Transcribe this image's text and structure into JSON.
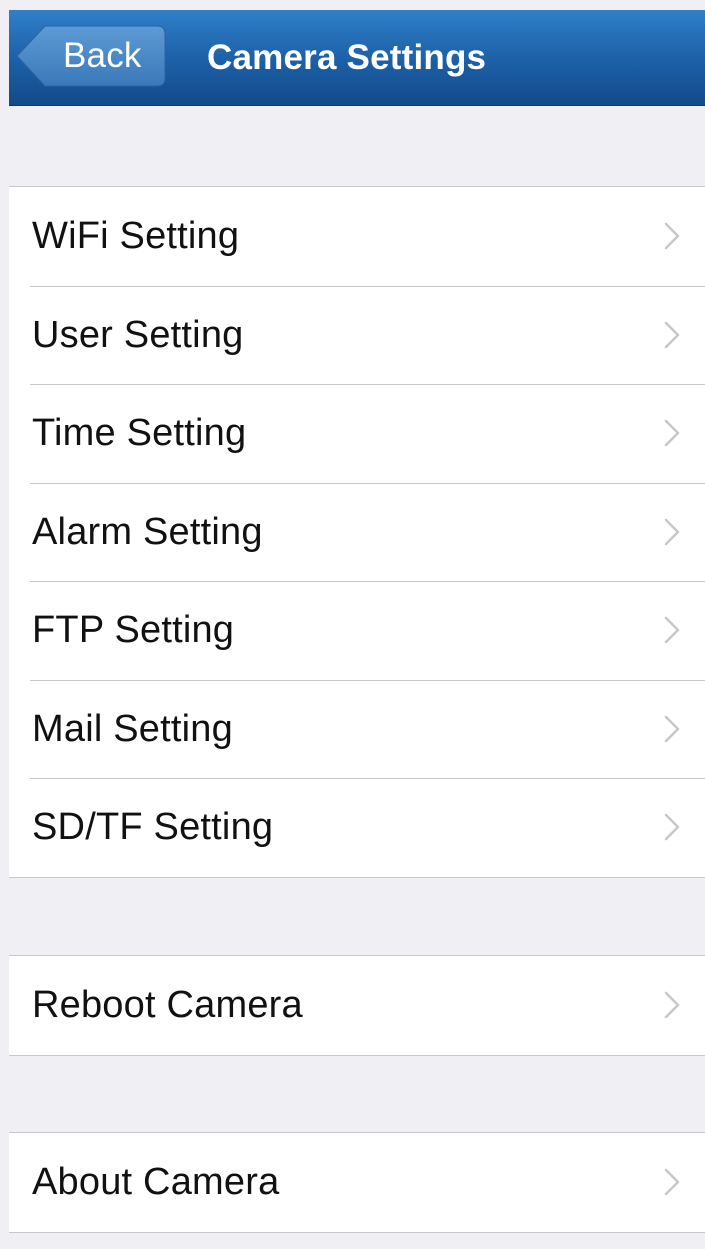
{
  "navbar": {
    "back_label": "Back",
    "title": "Camera Settings",
    "colors": {
      "top": "#2f7fc9",
      "bottom": "#134a8a"
    }
  },
  "groups": {
    "settings": [
      {
        "label": "WiFi Setting"
      },
      {
        "label": "User Setting"
      },
      {
        "label": "Time Setting"
      },
      {
        "label": "Alarm Setting"
      },
      {
        "label": "FTP Setting"
      },
      {
        "label": "Mail Setting"
      },
      {
        "label": "SD/TF Setting"
      }
    ],
    "reboot": [
      {
        "label": "Reboot Camera"
      }
    ],
    "about": [
      {
        "label": "About Camera"
      }
    ]
  },
  "icons": {
    "back": "back-arrow-icon",
    "disclosure": "chevron-right-icon"
  }
}
